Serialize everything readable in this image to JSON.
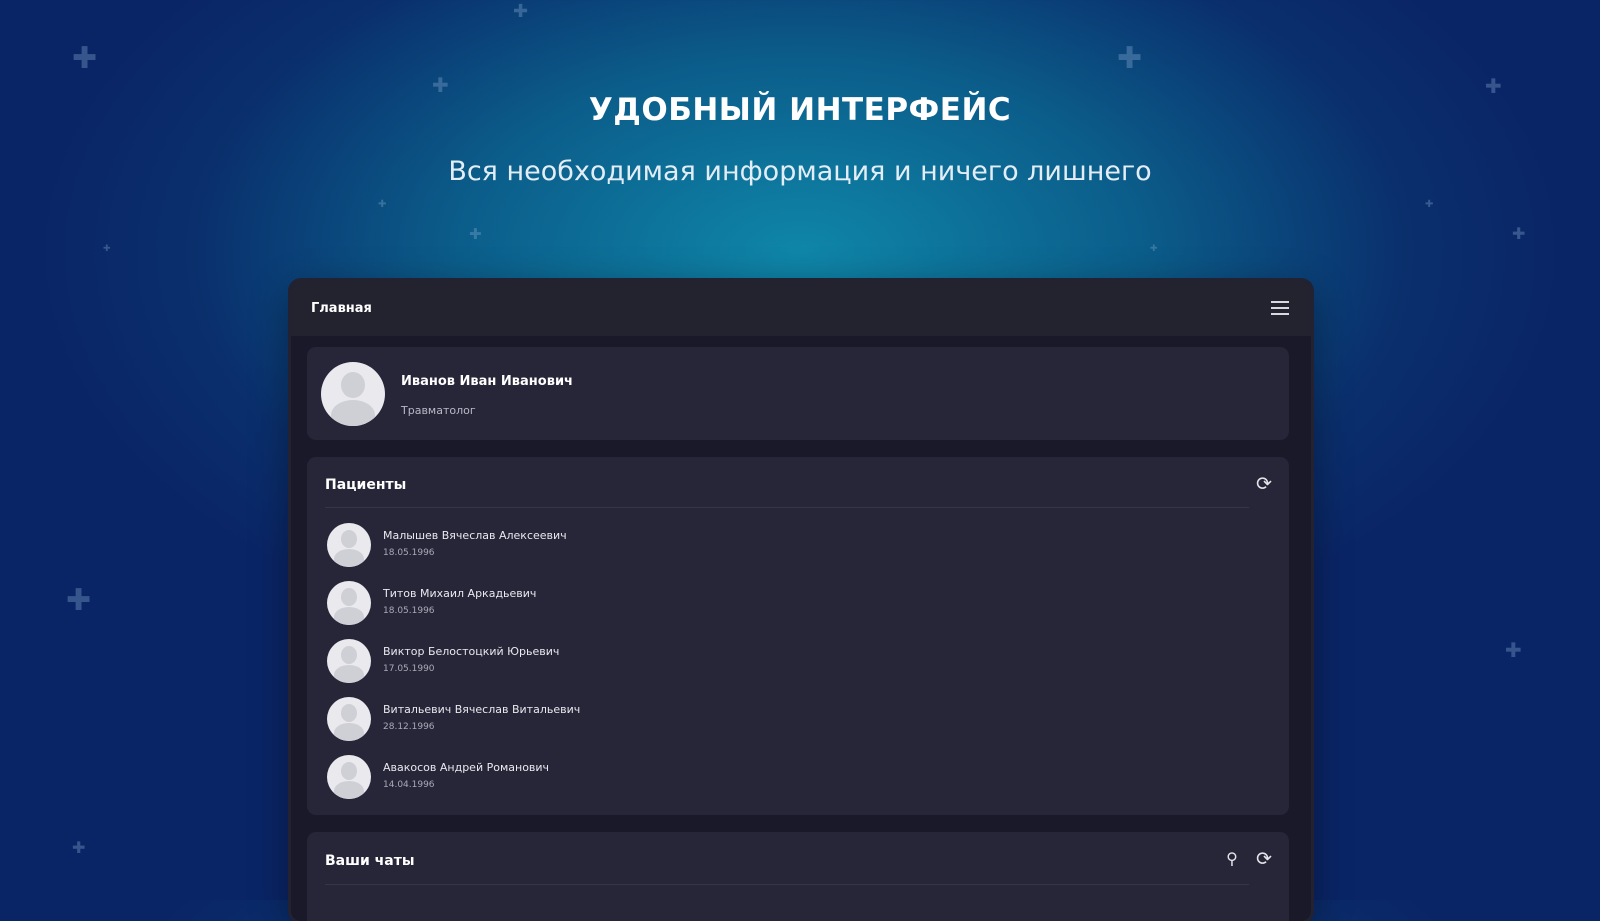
{
  "hero": {
    "title": "УДОБНЫЙ ИНТЕРФЕЙС",
    "subtitle": "Вся необходимая информация и ничего лишнего"
  },
  "app": {
    "topbar_title": "Главная",
    "menu_icon": "hamburger-menu-icon"
  },
  "profile": {
    "name": "Иванов Иван Иванович",
    "role": "Травматолог"
  },
  "patients": {
    "title": "Пациенты",
    "refresh_icon": "refresh-icon",
    "items": [
      {
        "name": "Малышев Вячеслав Алексеевич",
        "date": "18.05.1996"
      },
      {
        "name": "Титов Михаил Аркадьевич",
        "date": "18.05.1996"
      },
      {
        "name": "Виктор Белостоцкий Юрьевич",
        "date": "17.05.1990"
      },
      {
        "name": "Витальевич Вячеслав Витальевич",
        "date": "28.12.1996"
      },
      {
        "name": "Авакосов Андрей Романович",
        "date": "14.04.1996"
      }
    ]
  },
  "chats": {
    "title": "Ваши чаты",
    "search_icon": "search-icon",
    "refresh_icon": "refresh-icon"
  },
  "colors": {
    "background_center": "#0f86a8",
    "background_edge": "#0a2566",
    "card": "#262638",
    "topbar": "#23232f"
  }
}
